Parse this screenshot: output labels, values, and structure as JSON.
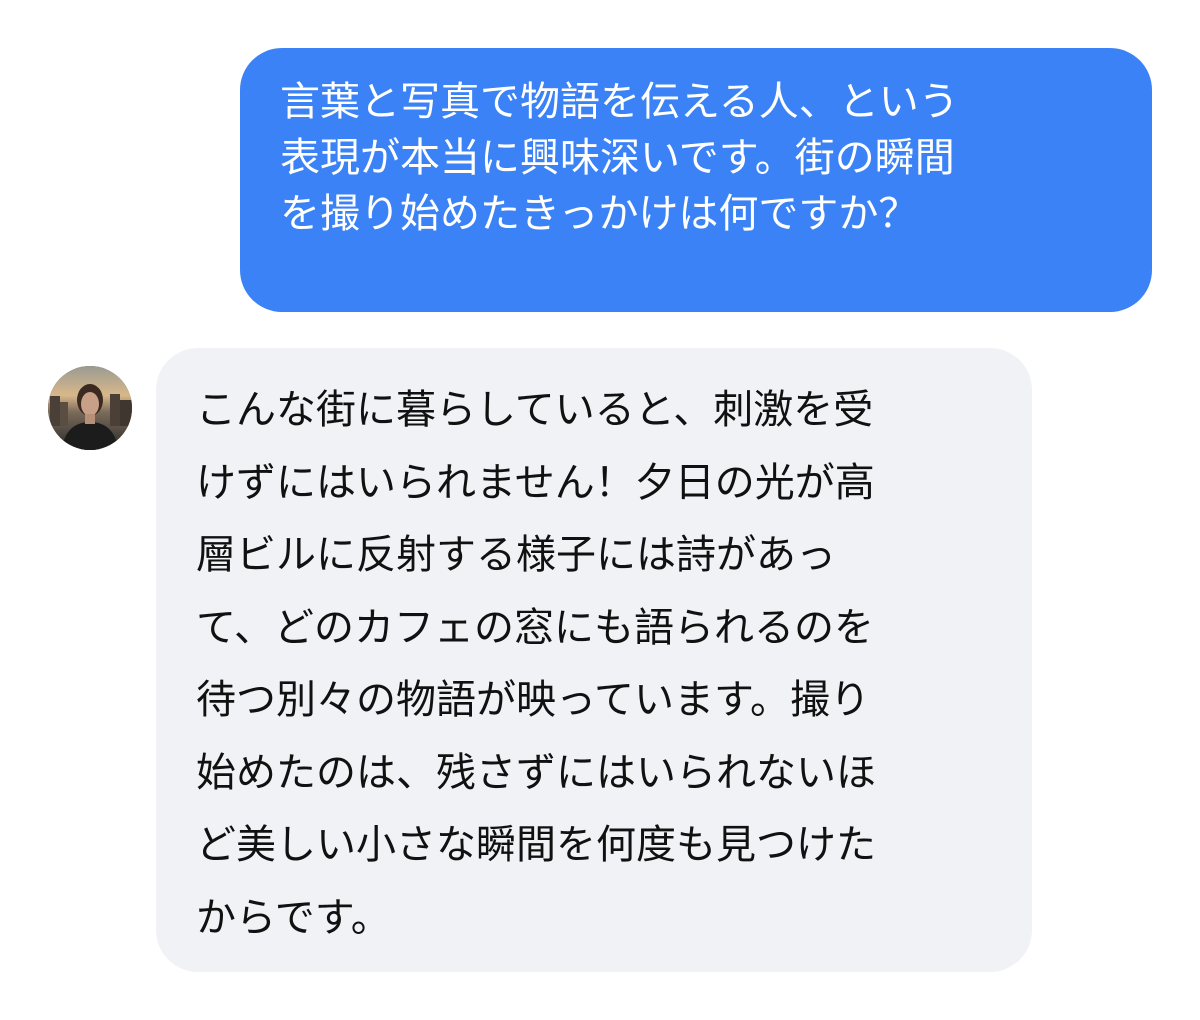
{
  "conversation": {
    "user_message": {
      "lines": "言葉と写真で物語を伝える人、という\n表現が本当に興味深いです。街の瞬間\nを撮り始めたきっかけは何ですか？"
    },
    "assistant_message": {
      "avatar_icon": "person-photo-avatar",
      "lines": "こんな街に暮らしていると、刺激を受\nけずにはいられません！夕日の光が高\n層ビルに反射する様子には詩があっ\nて、どのカフェの窓にも語られるのを\n待つ別々の物語が映っています。撮り\n始めたのは、残さずにはいられないほ\nど美しい小さな瞬間を何度も見つけた\nからです。"
    },
    "colors": {
      "user_bubble": "#3b82f6",
      "assistant_bubble": "#f1f2f6",
      "user_text": "#ffffff",
      "assistant_text": "#111111"
    }
  }
}
